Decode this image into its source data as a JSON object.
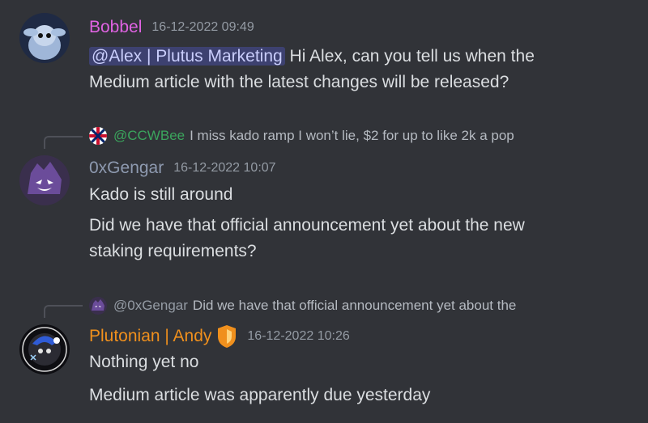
{
  "messages": [
    {
      "author": "Bobbel",
      "author_color": "#e063e3",
      "timestamp": "16-12-2022 09:49",
      "mention": "@Alex | Plutus Marketing",
      "line1_rest": " Hi Alex, can you tell us when the",
      "line2": "Medium article with the latest changes will be released?"
    },
    {
      "reply_to": {
        "author": "@CCWBee",
        "author_color": "#3ba55d",
        "text": "I miss kado ramp I won’t lie, $2 for up to like 2k a pop"
      },
      "author": "0xGengar",
      "author_color": "#8e9ab0",
      "timestamp": "16-12-2022 10:07",
      "lines": [
        "Kado is still around",
        "Did we have that official announcement yet about the new",
        "staking requirements?"
      ]
    },
    {
      "reply_to": {
        "author": "@0xGengar",
        "author_color": "#949ba4",
        "text": "Did we have that official announcement yet about the"
      },
      "author": "Plutonian | Andy",
      "author_color": "#f0901d",
      "timestamp": "16-12-2022 10:26",
      "lines": [
        "Nothing yet no",
        "Medium article was apparently due yesterday"
      ]
    }
  ]
}
